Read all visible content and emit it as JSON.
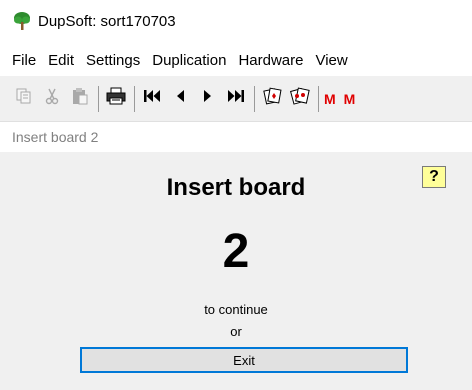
{
  "window": {
    "title": "DupSoft: sort170703",
    "icon": "tree-app-icon"
  },
  "menu": {
    "items": [
      "File",
      "Edit",
      "Settings",
      "Duplication",
      "Hardware",
      "View"
    ]
  },
  "toolbar": {
    "buttons": [
      {
        "icon": "copy-icon",
        "enabled": false
      },
      {
        "icon": "cut-icon",
        "enabled": false
      },
      {
        "icon": "paste-icon",
        "enabled": false
      },
      {
        "icon": "print-icon",
        "enabled": true
      },
      {
        "icon": "first-icon",
        "enabled": true
      },
      {
        "icon": "previous-icon",
        "enabled": true
      },
      {
        "icon": "next-icon",
        "enabled": true
      },
      {
        "icon": "last-icon",
        "enabled": true
      },
      {
        "icon": "cards-icon",
        "enabled": true
      },
      {
        "icon": "cards-red-icon",
        "enabled": true
      }
    ],
    "text_buttons": [
      "M",
      "M"
    ],
    "accent_color": "#e00000"
  },
  "status": {
    "text": "Insert board 2"
  },
  "dialog": {
    "help_label": "?",
    "heading": "Insert board",
    "board_number": "2",
    "continue_text": "to continue",
    "or_text": "or",
    "exit_label": "Exit",
    "focus_color": "#0078d7",
    "help_bg": "#ffff99"
  }
}
